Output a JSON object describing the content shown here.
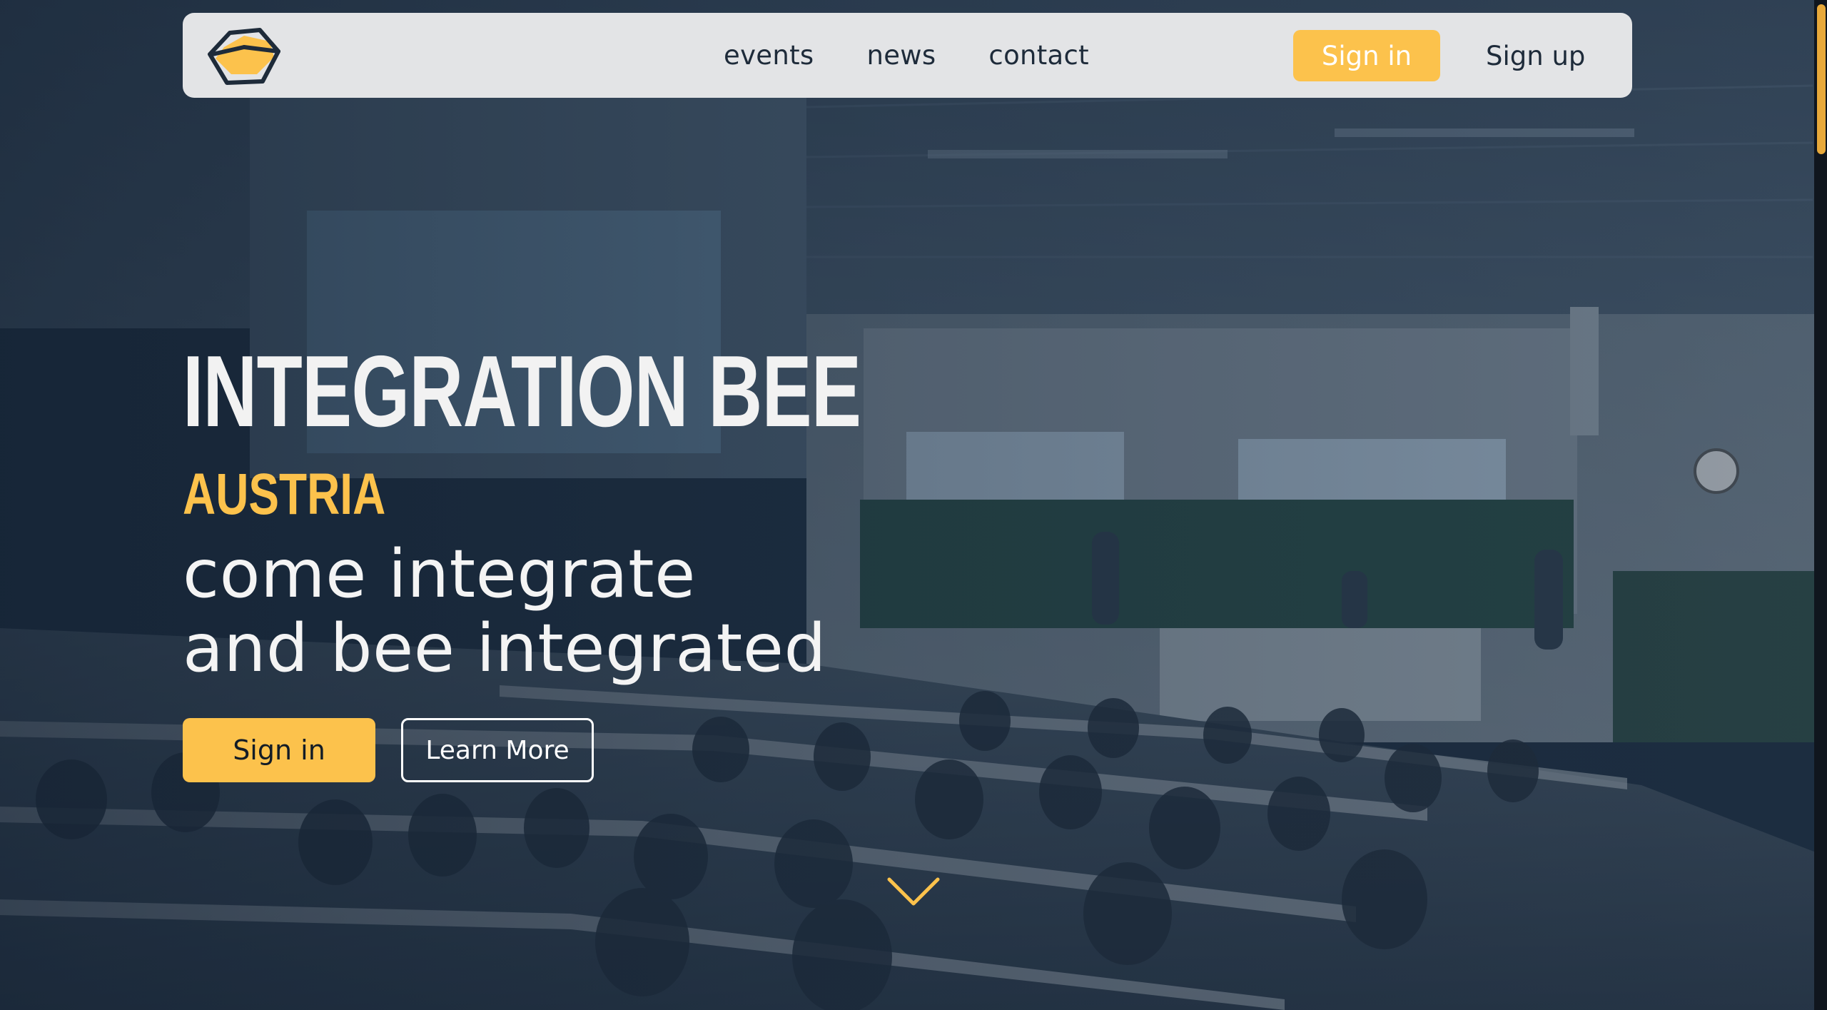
{
  "nav": {
    "logo_icon": "hexagon-bee-logo-icon",
    "links": [
      "events",
      "news",
      "contact"
    ],
    "signin_label": "Sign in",
    "signup_label": "Sign up"
  },
  "hero": {
    "title": "INTEGRATION BEE",
    "subtitle": "AUSTRIA",
    "tagline_line1": "come integrate",
    "tagline_line2": "and bee integrated",
    "signin_label": "Sign in",
    "learn_more_label": "Learn More",
    "scroll_icon": "chevron-down-icon"
  },
  "colors": {
    "accent": "#fcc24c",
    "nav_bg": "#e3e4e6",
    "text_dark": "#1e2b3a",
    "overlay": "#1b2a3b"
  }
}
